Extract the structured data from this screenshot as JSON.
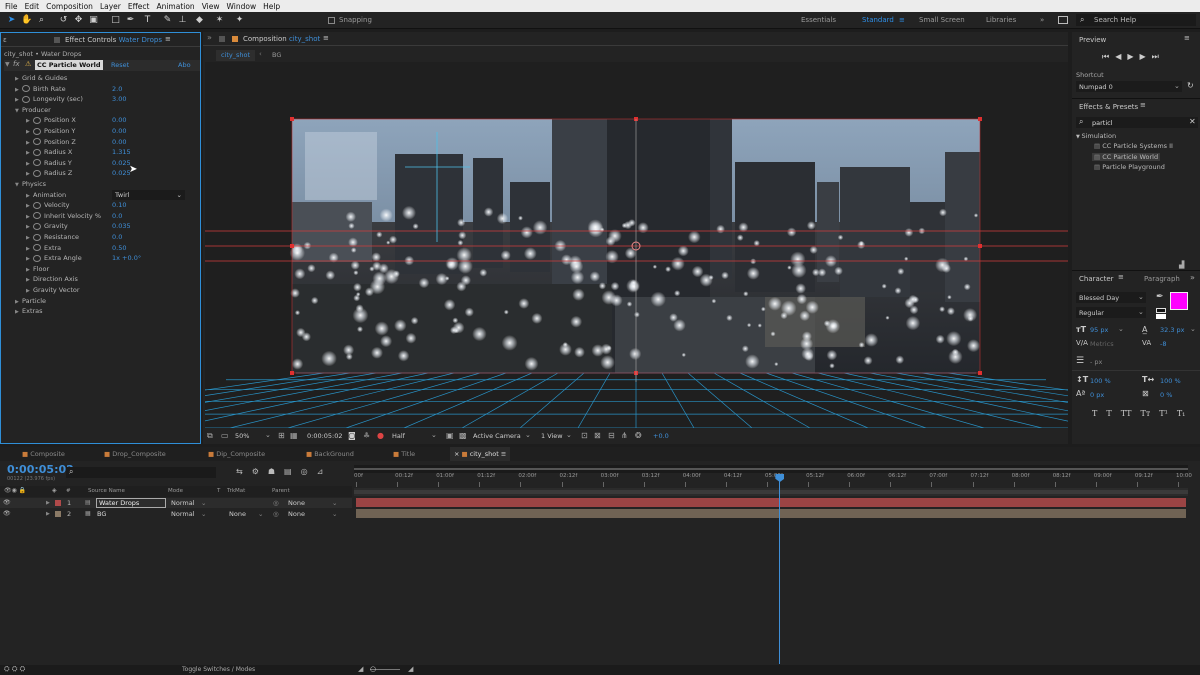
{
  "menubar": [
    "File",
    "Edit",
    "Composition",
    "Layer",
    "Effect",
    "Animation",
    "View",
    "Window",
    "Help"
  ],
  "toolbar": {
    "snapping_label": "Snapping",
    "workspaces": [
      "Essentials",
      "Standard",
      "Small Screen",
      "Libraries"
    ],
    "active_workspace": "Standard",
    "search_help": "Search Help"
  },
  "effect_controls": {
    "tab_label": "Effect Controls",
    "tab_layer": "Water Drops",
    "breadcrumb": "city_shot • Water Drops",
    "effect_name": "CC Particle World",
    "reset": "Reset",
    "about": "Abo",
    "rows": [
      {
        "label": "Grid & Guides",
        "indent": 1,
        "value": ""
      },
      {
        "label": "Birth Rate",
        "indent": 1,
        "value": "2.0",
        "sw": true
      },
      {
        "label": "Longevity (sec)",
        "indent": 1,
        "value": "3.00",
        "sw": true
      },
      {
        "label": "Producer",
        "indent": 1,
        "value": "",
        "open": true
      },
      {
        "label": "Position X",
        "indent": 2,
        "value": "0.00",
        "sw": true
      },
      {
        "label": "Position Y",
        "indent": 2,
        "value": "0.00",
        "sw": true
      },
      {
        "label": "Position Z",
        "indent": 2,
        "value": "0.00",
        "sw": true
      },
      {
        "label": "Radius X",
        "indent": 2,
        "value": "1.315",
        "sw": true
      },
      {
        "label": "Radius Y",
        "indent": 2,
        "value": "0.025",
        "sw": true
      },
      {
        "label": "Radius Z",
        "indent": 2,
        "value": "0.025",
        "sw": true
      },
      {
        "label": "Physics",
        "indent": 1,
        "value": "",
        "open": true
      },
      {
        "label": "Animation",
        "indent": 2,
        "value": "Twirl",
        "dropdown": true
      },
      {
        "label": "Velocity",
        "indent": 2,
        "value": "0.10",
        "sw": true
      },
      {
        "label": "Inherit Velocity %",
        "indent": 2,
        "value": "0.0",
        "sw": true
      },
      {
        "label": "Gravity",
        "indent": 2,
        "value": "0.035",
        "sw": true
      },
      {
        "label": "Resistance",
        "indent": 2,
        "value": "0.0",
        "sw": true
      },
      {
        "label": "Extra",
        "indent": 2,
        "value": "0.50",
        "sw": true
      },
      {
        "label": "Extra Angle",
        "indent": 2,
        "value": "1x +0.0°",
        "sw": true
      },
      {
        "label": "Floor",
        "indent": 2,
        "value": ""
      },
      {
        "label": "Direction Axis",
        "indent": 2,
        "value": ""
      },
      {
        "label": "Gravity Vector",
        "indent": 2,
        "value": ""
      },
      {
        "label": "Particle",
        "indent": 1,
        "value": ""
      },
      {
        "label": "Extras",
        "indent": 1,
        "value": ""
      }
    ]
  },
  "composition": {
    "tab_label": "Composition",
    "tab_comp": "city_shot",
    "flow_items": [
      "city_shot",
      "BG"
    ],
    "footer": {
      "zoom": "50%",
      "timecode": "0:00:05:02",
      "resolution": "Half",
      "camera": "Active Camera",
      "views": "1 View",
      "exposure": "+0.0"
    }
  },
  "preview": {
    "title": "Preview"
  },
  "shortcut": {
    "label": "Shortcut",
    "value": "Numpad 0"
  },
  "effects_presets": {
    "title": "Effects & Presets",
    "search_value": "particl",
    "category": "Simulation",
    "items": [
      "CC Particle Systems II",
      "CC Particle World",
      "Particle Playground"
    ],
    "selected": "CC Particle World"
  },
  "character": {
    "tab_character": "Character",
    "tab_paragraph": "Paragraph",
    "font": "Blessed Day",
    "style": "Regular",
    "size": "95 px",
    "leading": "32.3 px",
    "kerning": "Metrics",
    "tracking": "-8",
    "stroke_unit": "- px",
    "vscale": "100 %",
    "hscale": "100 %",
    "baseline": "0 px",
    "tsume": "0 %",
    "fill_color": "#ff00ff",
    "format_buttons": [
      "T",
      "T",
      "TT",
      "Tт",
      "T¹",
      "T₁"
    ]
  },
  "timeline": {
    "tabs": [
      "Composite",
      "Drop_Composite",
      "Dip_Composite",
      "BackGround",
      "Title",
      "city_shot"
    ],
    "active_tab": "city_shot",
    "timecode": "0:00:05:02",
    "fps_info": "00122 (23.976 fps)",
    "columns": [
      "#",
      "Source Name",
      "Mode",
      "T",
      "TrkMat",
      "Parent"
    ],
    "layers": [
      {
        "num": "1",
        "name": "Water Drops",
        "mode": "Normal",
        "trkmat": "",
        "parent": "None",
        "color": "#b04a4a"
      },
      {
        "num": "2",
        "name": "BG",
        "mode": "Normal",
        "trkmat": "None",
        "parent": "None",
        "color": "#8b7a66"
      }
    ],
    "ruler": [
      "00f",
      "00:12f",
      "01:00f",
      "01:12f",
      "02:00f",
      "02:12f",
      "03:00f",
      "03:12f",
      "04:00f",
      "04:12f",
      "05:00f",
      "05:12f",
      "06:00f",
      "06:12f",
      "07:00f",
      "07:12f",
      "08:00f",
      "08:12f",
      "09:00f",
      "09:12f",
      "10:00"
    ],
    "playhead_time_fraction": 0.51
  },
  "statusbar": {
    "toggle_label": "Toggle Switches / Modes"
  }
}
